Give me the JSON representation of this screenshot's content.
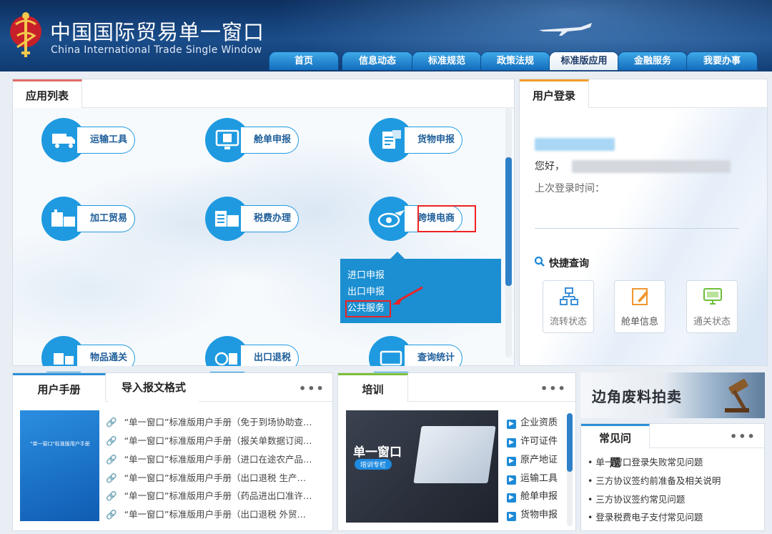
{
  "header": {
    "title_cn": "中国国际贸易单一窗口",
    "title_en": "China International Trade Single Window",
    "tabs": [
      "首页",
      "信息动态",
      "标准规范",
      "政策法规",
      "标准版应用",
      "金融服务",
      "我要办事"
    ],
    "active_tab": "标准版应用"
  },
  "apps": {
    "tab": "应用列表",
    "items": [
      "运输工具",
      "舱单申报",
      "货物申报",
      "加工贸易",
      "税费办理",
      "跨境电商",
      "物品通关",
      "出口退税",
      "查询统计"
    ],
    "popup": [
      "进口申报",
      "出口申报",
      "公共服务"
    ]
  },
  "login": {
    "tab": "用户登录",
    "greeting": "您好，",
    "last_login": "上次登录时间：",
    "quick_title": "快捷查询",
    "quick": [
      "流转状态",
      "舱单信息",
      "通关状态"
    ]
  },
  "manual": {
    "tabs": [
      "用户手册",
      "导入报文格式"
    ],
    "more": "•••",
    "cover_title": "\"单一窗口\"标准版用户手册",
    "items": [
      "“单一窗口”标准版用户手册（免于到场协助查…",
      "“单一窗口”标准版用户手册（报关单数据订阅…",
      "“单一窗口”标准版用户手册（进口在途农产品…",
      "“单一窗口”标准版用户手册（出口退税 生产…",
      "“单一窗口”标准版用户手册（药品进出口准许…",
      "“单一窗口”标准版用户手册（出口退税 外贸…"
    ]
  },
  "training": {
    "tab": "培训",
    "more": "•••",
    "image_title": "单一窗口",
    "image_sub": "培训专栏",
    "items": [
      "企业资质",
      "许可证件",
      "原产地证",
      "运输工具",
      "舱单申报",
      "货物申报"
    ]
  },
  "banner": {
    "text": "边角废料拍卖"
  },
  "faq": {
    "tab": "常见问题",
    "more": "•••",
    "items": [
      "单一窗口登录失败常见问题",
      "三方协议签约前准备及相关说明",
      "三方协议签约常见问题",
      "登录税费电子支付常见问题"
    ]
  }
}
